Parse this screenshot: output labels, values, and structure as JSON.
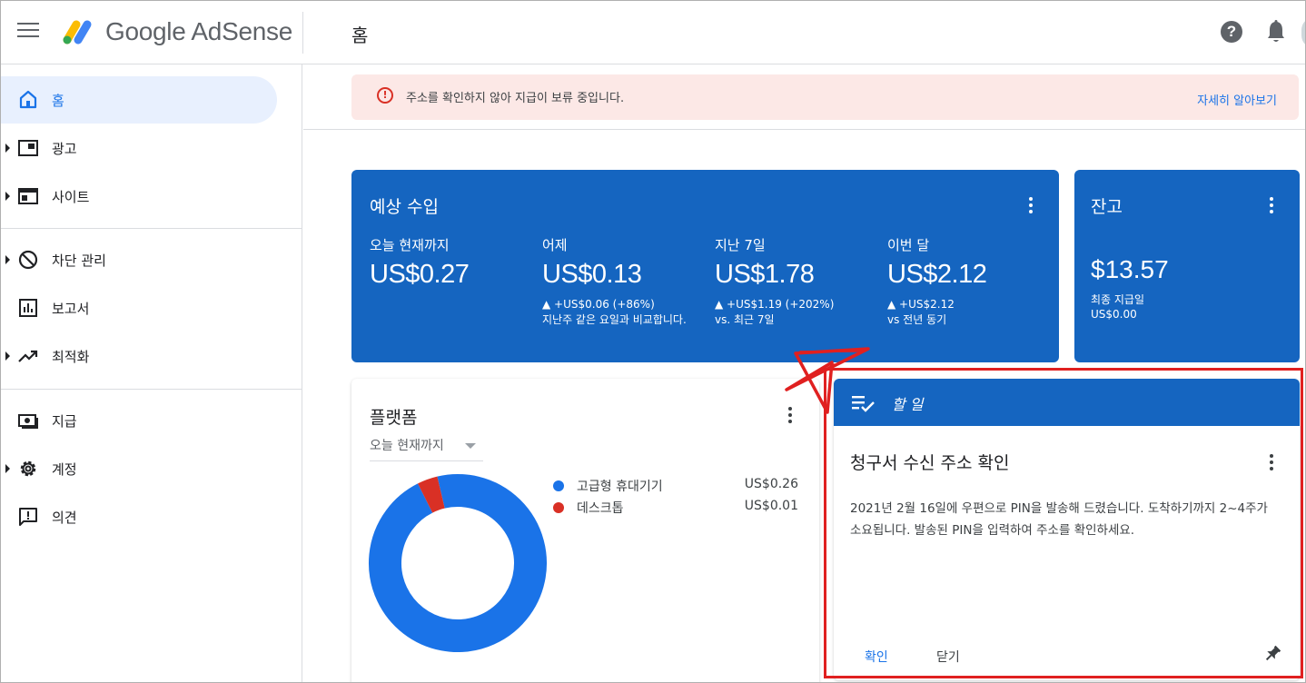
{
  "app": {
    "brand": "Google AdSense",
    "page_title": "홈"
  },
  "sidebar": {
    "items": [
      {
        "label": "홈",
        "icon": "home-icon"
      },
      {
        "label": "광고",
        "icon": "ads-icon"
      },
      {
        "label": "사이트",
        "icon": "sites-icon"
      },
      {
        "label": "차단 관리",
        "icon": "block-icon"
      },
      {
        "label": "보고서",
        "icon": "reports-icon"
      },
      {
        "label": "최적화",
        "icon": "trending-icon"
      },
      {
        "label": "지급",
        "icon": "payments-icon"
      },
      {
        "label": "계정",
        "icon": "gear-icon"
      },
      {
        "label": "의견",
        "icon": "feedback-icon"
      }
    ]
  },
  "alert": {
    "text": "주소를 확인하지 않아 지급이 보류 중입니다.",
    "link": "자세히 알아보기"
  },
  "earnings": {
    "title": "예상 수입",
    "metrics": [
      {
        "label": "오늘 현재까지",
        "value": "US$0.27",
        "sub1": "",
        "sub2": ""
      },
      {
        "label": "어제",
        "value": "US$0.13",
        "sub1": "▲ +US$0.06 (+86%)",
        "sub2": "지난주 같은 요일과 비교합니다."
      },
      {
        "label": "지난 7일",
        "value": "US$1.78",
        "sub1": "▲ +US$1.19 (+202%)",
        "sub2": "vs. 최근 7일"
      },
      {
        "label": "이번 달",
        "value": "US$2.12",
        "sub1": "▲ +US$2.12",
        "sub2": "vs 전년 동기"
      }
    ]
  },
  "balance": {
    "title": "잔고",
    "value": "$13.57",
    "sub1": "최종 지급일",
    "sub2": "US$0.00"
  },
  "platform": {
    "title": "플랫폼",
    "range": "오늘 현재까지",
    "legend": [
      {
        "name": "고급형 휴대기기",
        "value": "US$0.26",
        "color": "#1a73e8"
      },
      {
        "name": "데스크톱",
        "value": "US$0.01",
        "color": "#d93025"
      }
    ]
  },
  "chart_data": {
    "type": "pie",
    "title": "플랫폼",
    "categories": [
      "고급형 휴대기기",
      "데스크톱"
    ],
    "values": [
      0.26,
      0.01
    ],
    "colors": [
      "#1a73e8",
      "#d93025"
    ],
    "donut": true
  },
  "todo": {
    "header": "할 일",
    "title": "청구서 수신 주소 확인",
    "body": "2021년 2월 16일에 우편으로 PIN을 발송해 드렸습니다. 도착하기까지 2~4주가 소요됩니다. 발송된 PIN을 입력하여 주소를 확인하세요.",
    "confirm": "확인",
    "close": "닫기"
  },
  "colors": {
    "primary": "#1565c0",
    "link": "#1a73e8",
    "alert_bg": "#fce8e6",
    "alert_icon": "#d93025",
    "highlight": "#e02020"
  }
}
